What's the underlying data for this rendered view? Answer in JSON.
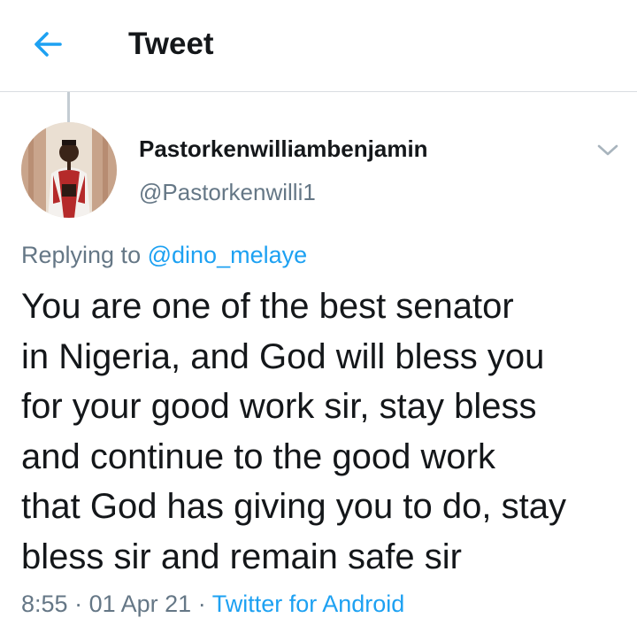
{
  "header": {
    "back_icon": "arrow-left-icon",
    "title": "Tweet",
    "accent_color": "#1da1f2"
  },
  "tweet": {
    "author": {
      "display_name": "Pastorkenwilliambenjamin",
      "handle": "@Pastorkenwilli1",
      "avatar": "avatar-photo"
    },
    "menu_icon": "chevron-down-icon",
    "replying_prefix": "Replying to",
    "replying_to": "@dino_melaye",
    "text_lines": [
      "You are one of the best senator",
      "in Nigeria, and God will bless you",
      "for your good work sir, stay bless",
      "and continue to the good work",
      "that God has giving you to do, stay",
      "bless sir and remain safe sir"
    ],
    "time": "8:55",
    "separator": "·",
    "date": "01 Apr 21",
    "source": "Twitter for Android"
  }
}
